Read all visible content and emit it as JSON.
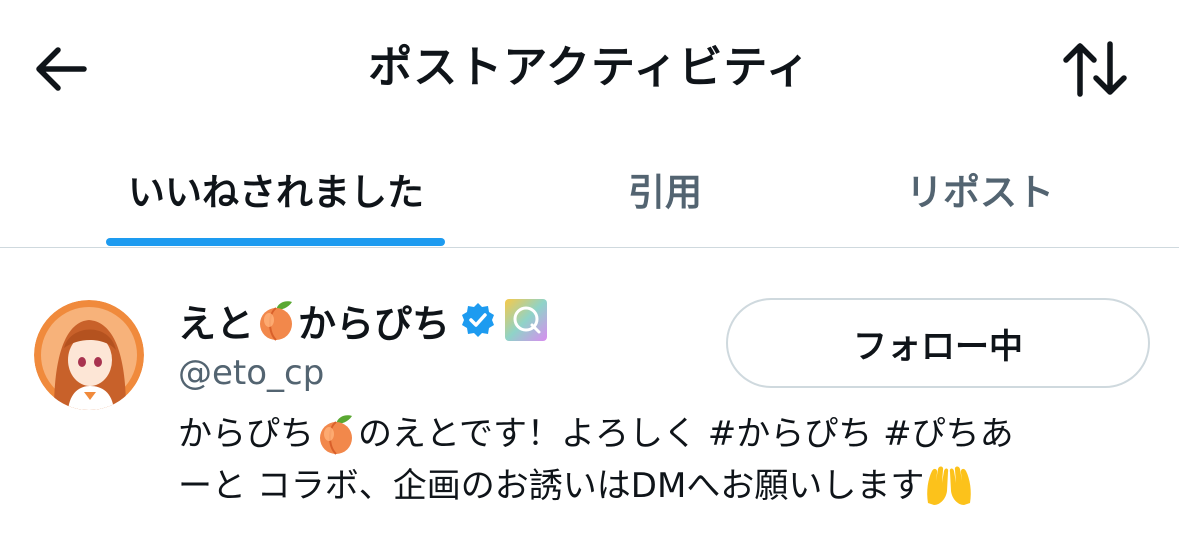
{
  "header": {
    "title": "ポストアクティビティ",
    "back_icon": "arrow-left-icon",
    "sort_icon": "sort-arrows-icon"
  },
  "tabs": [
    {
      "label": "いいねされました",
      "active": true
    },
    {
      "label": "引用",
      "active": false
    },
    {
      "label": "リポスト",
      "active": false
    }
  ],
  "colors": {
    "accent": "#1d9bf0",
    "text_primary": "#0f1419",
    "text_secondary": "#536471",
    "border": "#cfd9de"
  },
  "user": {
    "name_part1": "えと",
    "name_emoji": "peach-emoji",
    "name_part2": "からぴち",
    "verified_icon": "verified-badge-icon",
    "affiliate_icon": "affiliate-badge-icon",
    "handle": "@eto_cp",
    "follow_button": "フォロー中",
    "bio_line1_a": "からぴち",
    "bio_line1_b": "のえとです！よろしく #からぴち #ぴちあ",
    "bio_line2": "ーと コラボ、企画のお誘いはDMへお願いします",
    "bio_end_emoji": "raising-hands-emoji"
  }
}
